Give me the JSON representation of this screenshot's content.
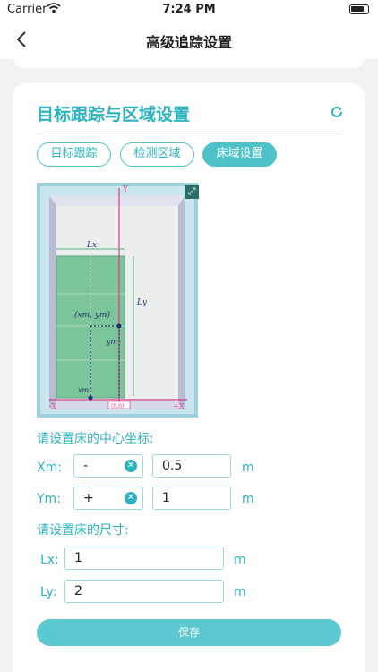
{
  "status_bar": {
    "carrier": "Carrier",
    "time": "7:24 PM"
  },
  "nav": {
    "back_icon": "chevron-left-icon",
    "title": "高级追踪设置"
  },
  "card": {
    "title": "目标跟踪与区域设置",
    "refresh_icon": "refresh-icon",
    "tabs": [
      {
        "label": "目标跟踪",
        "active": false
      },
      {
        "label": "检测区域",
        "active": false
      },
      {
        "label": "床域设置",
        "active": true
      }
    ]
  },
  "diagram": {
    "lx_label": "Lx",
    "ly_label": "Ly",
    "point_label": "(xm, ym)",
    "ym_label": "ym",
    "xm_label": "xm",
    "origin_label": "(0,0)",
    "y_axis": "Y",
    "x_neg": "-X",
    "x_pos": "+X"
  },
  "center": {
    "heading": "请设置床的中心坐标:",
    "xm_label": "Xm:",
    "xm_sign": "-",
    "xm_value": "0.5",
    "ym_label": "Ym:",
    "ym_sign": "+",
    "ym_value": "1",
    "unit": "m"
  },
  "size": {
    "heading": "请设置床的尺寸:",
    "lx_label": "Lx:",
    "lx_value": "1",
    "ly_label": "Ly:",
    "ly_value": "2",
    "unit": "m"
  },
  "save_label": "保存",
  "colors": {
    "accent": "#2bb3bf",
    "button": "#5cc8cf",
    "bed": "#7cc59a"
  }
}
